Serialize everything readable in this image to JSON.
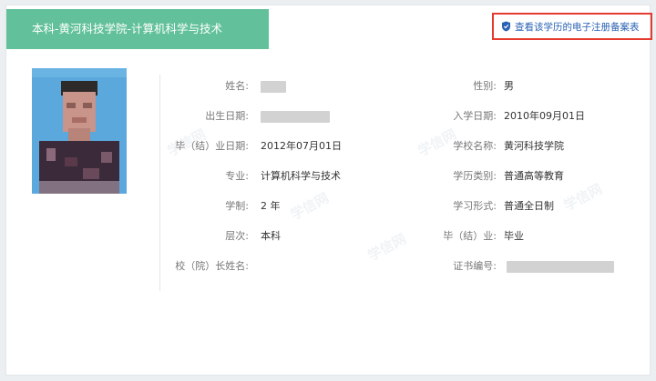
{
  "header": {
    "title": "本科-黄河科技学院-计算机科学与技术",
    "verify_link": "查看该学历的电子注册备案表"
  },
  "watermark": "学信网",
  "left_fields": [
    {
      "label": "姓名:",
      "value": ""
    },
    {
      "label": "出生日期:",
      "value": ""
    },
    {
      "label": "毕（结）业日期:",
      "value": "2012年07月01日"
    },
    {
      "label": "专业:",
      "value": "计算机科学与技术"
    },
    {
      "label": "学制:",
      "value": "2 年"
    },
    {
      "label": "层次:",
      "value": "本科"
    },
    {
      "label": "校（院）长姓名:",
      "value": ""
    }
  ],
  "right_fields": [
    {
      "label": "性别:",
      "value": "男"
    },
    {
      "label": "入学日期:",
      "value": "2010年09月01日"
    },
    {
      "label": "学校名称:",
      "value": "黄河科技学院"
    },
    {
      "label": "学历类别:",
      "value": "普通高等教育"
    },
    {
      "label": "学习形式:",
      "value": "普通全日制"
    },
    {
      "label": "毕（结）业:",
      "value": "毕业"
    },
    {
      "label": "证书编号:",
      "value": ""
    }
  ],
  "colors": {
    "banner": "#62c19a",
    "link": "#2a62b4",
    "highlight_border": "#e53a2f"
  }
}
